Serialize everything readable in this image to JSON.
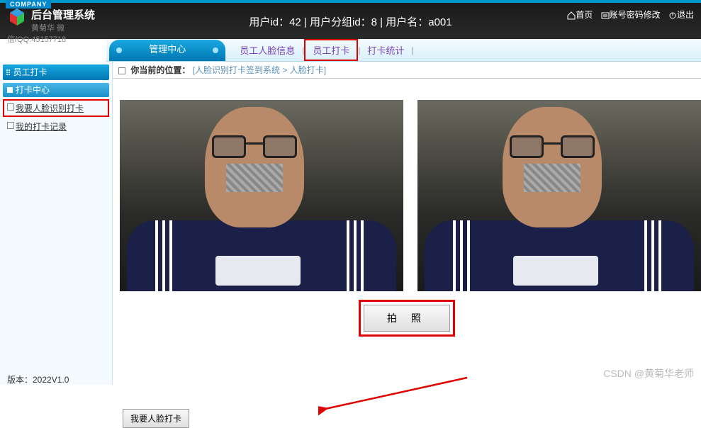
{
  "company_tag": "COMPANY",
  "header": {
    "title": "后台管理系统",
    "subtitle": "黄菊华 微信/QQ:45157718",
    "center_text": "用户id：42 | 用户分组id：8 | 用户名：a001",
    "links": {
      "home": "首页",
      "account": "账号密码修改",
      "logout": "退出"
    }
  },
  "mgmt_tab": "管理中心",
  "subtabs": {
    "faceinfo": "员工人脸信息",
    "checkin": "员工打卡",
    "stats": "打卡统计",
    "sep": "|"
  },
  "sidebar": {
    "section": "员工打卡",
    "group": "打卡中心",
    "items": {
      "recognize": "我要人脸识别打卡",
      "records": "我的打卡记录"
    }
  },
  "crumb": {
    "label": "你当前的位置：",
    "path": "[人脸识别打卡签到系统 > 人脸打卡]"
  },
  "buttons": {
    "capture": "拍 照",
    "submit": "我要人脸打卡"
  },
  "footer": {
    "version": "版本：2022V1.0"
  },
  "watermark": "CSDN @黄菊华老师"
}
